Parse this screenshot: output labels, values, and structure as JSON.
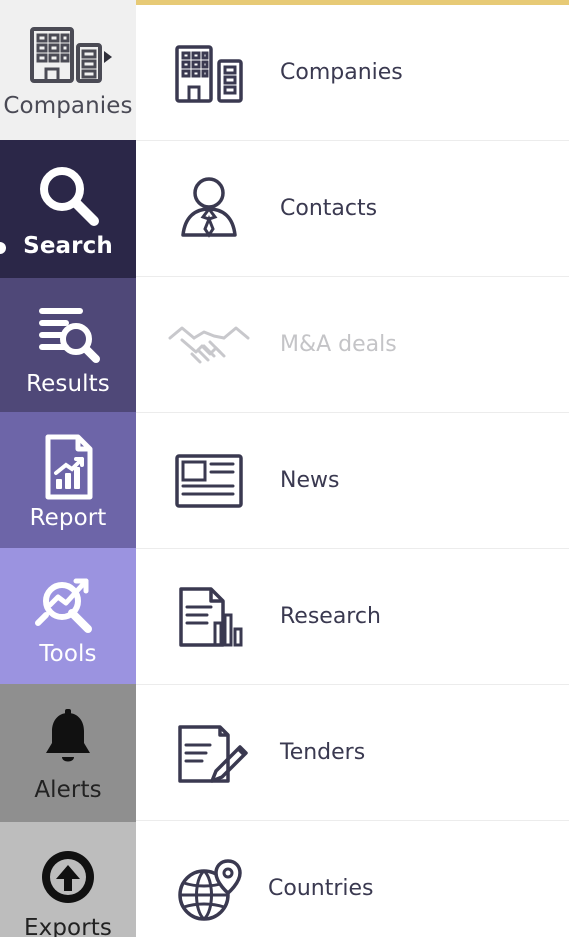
{
  "colors": {
    "accent_top": "#e6c76f",
    "rail_companies": "#f0f0f0",
    "rail_search": "#2b2748",
    "rail_results": "#4f4878",
    "rail_report": "#6d65a8",
    "rail_tools": "#9b93e0",
    "rail_alerts": "#8f8f8f",
    "rail_exports": "#bdbdbd",
    "menu_text": "#3a3950",
    "menu_disabled_text": "#c4c4c7"
  },
  "left_rail": {
    "items": [
      {
        "id": "companies",
        "label": "Companies",
        "icon": "building-icon"
      },
      {
        "id": "search",
        "label": "Search",
        "icon": "search-icon"
      },
      {
        "id": "results",
        "label": "Results",
        "icon": "results-list-icon"
      },
      {
        "id": "report",
        "label": "Report",
        "icon": "report-chart-icon"
      },
      {
        "id": "tools",
        "label": "Tools",
        "icon": "tools-analytics-icon"
      },
      {
        "id": "alerts",
        "label": "Alerts",
        "icon": "bell-icon"
      },
      {
        "id": "exports",
        "label": "Exports",
        "icon": "upload-circle-icon"
      }
    ]
  },
  "menu": {
    "items": [
      {
        "id": "companies",
        "label": "Companies",
        "icon": "building-icon",
        "enabled": true
      },
      {
        "id": "contacts",
        "label": "Contacts",
        "icon": "person-tie-icon",
        "enabled": true
      },
      {
        "id": "ma_deals",
        "label": "M&A deals",
        "icon": "handshake-icon",
        "enabled": false
      },
      {
        "id": "news",
        "label": "News",
        "icon": "newspaper-icon",
        "enabled": true
      },
      {
        "id": "research",
        "label": "Research",
        "icon": "research-doc-icon",
        "enabled": true
      },
      {
        "id": "tenders",
        "label": "Tenders",
        "icon": "contract-pen-icon",
        "enabled": true
      },
      {
        "id": "countries",
        "label": "Countries",
        "icon": "globe-pin-icon",
        "enabled": true
      }
    ]
  }
}
